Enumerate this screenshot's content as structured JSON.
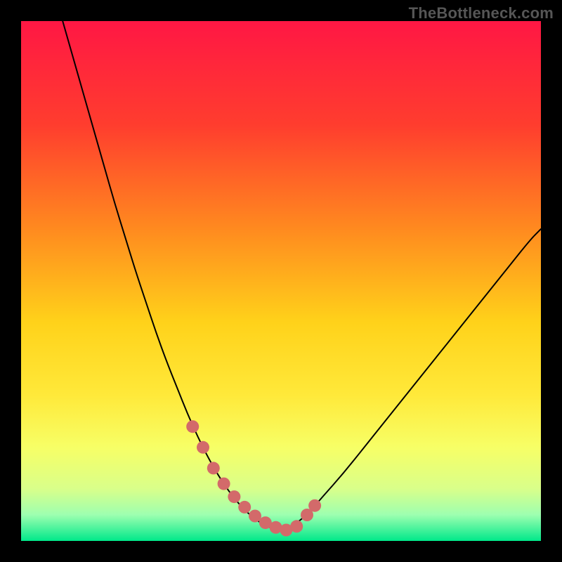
{
  "watermark": "TheBottleneck.com",
  "chart_data": {
    "type": "line",
    "title": "",
    "xlabel": "",
    "ylabel": "",
    "xlim": [
      0,
      100
    ],
    "ylim": [
      0,
      100
    ],
    "grid": false,
    "legend": false,
    "gradient_stops": [
      {
        "offset": 0,
        "color": "#ff1744"
      },
      {
        "offset": 20,
        "color": "#ff3d2e"
      },
      {
        "offset": 40,
        "color": "#ff8a1f"
      },
      {
        "offset": 58,
        "color": "#ffd21a"
      },
      {
        "offset": 72,
        "color": "#ffe93a"
      },
      {
        "offset": 82,
        "color": "#f7ff66"
      },
      {
        "offset": 90,
        "color": "#d9ff8a"
      },
      {
        "offset": 95,
        "color": "#9dffb0"
      },
      {
        "offset": 100,
        "color": "#00e88a"
      }
    ],
    "series": [
      {
        "name": "bottleneck-curve",
        "stroke": "#000000",
        "x": [
          8,
          10,
          12,
          14,
          16,
          18,
          20,
          22,
          24,
          26,
          28,
          30,
          32,
          34,
          36,
          38,
          40,
          42,
          44,
          46,
          48,
          50,
          52,
          55,
          58,
          62,
          66,
          70,
          74,
          78,
          82,
          86,
          90,
          94,
          98,
          100
        ],
        "y": [
          100,
          93,
          86,
          79,
          72,
          65,
          58.5,
          52,
          46,
          40,
          34.5,
          29.5,
          24.5,
          20,
          16,
          12.5,
          9.5,
          7,
          5,
          3.5,
          2.5,
          2,
          2.7,
          5,
          8.5,
          13,
          18,
          23,
          28,
          33,
          38,
          43,
          48,
          53,
          58,
          60
        ]
      }
    ],
    "markers": {
      "name": "highlight-region",
      "color": "#d36a6a",
      "x": [
        33,
        35,
        37,
        39,
        41,
        43,
        45,
        47,
        49,
        51,
        53,
        55,
        56.5
      ],
      "y": [
        22,
        18,
        14,
        11,
        8.5,
        6.5,
        4.8,
        3.5,
        2.6,
        2.1,
        2.8,
        5,
        6.8
      ]
    }
  }
}
